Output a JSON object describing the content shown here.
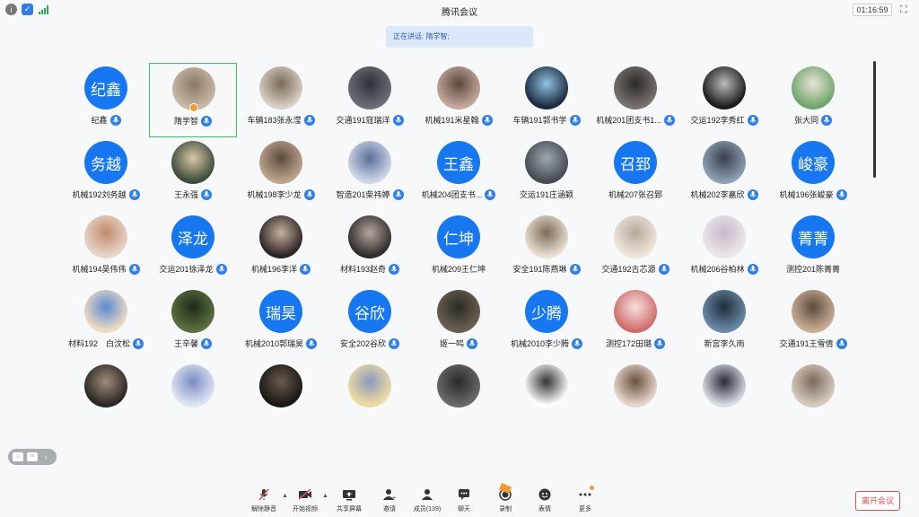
{
  "window": {
    "title": "腾讯会议",
    "timer": "01:16:59"
  },
  "speaking": "正在讲话: 隋学智;",
  "participants": [
    {
      "name": "纪鑫",
      "avatar_text": "纪鑫",
      "mic": true
    },
    {
      "name": "隋学智",
      "avatar_text": "",
      "mic": true,
      "active": true,
      "host": true
    },
    {
      "name": "车辆183张永滢",
      "avatar_text": "",
      "mic": true
    },
    {
      "name": "交通191寇瑞洋",
      "avatar_text": "",
      "mic": true
    },
    {
      "name": "机械191米星翰",
      "avatar_text": "",
      "mic": true
    },
    {
      "name": "车辆191郭书学",
      "avatar_text": "",
      "mic": true
    },
    {
      "name": "机械201团支书1...",
      "avatar_text": "",
      "mic": true
    },
    {
      "name": "交运192李秀红",
      "avatar_text": "",
      "mic": true
    },
    {
      "name": "张大同",
      "avatar_text": "",
      "mic": true
    },
    {
      "name": "机械192刘务越",
      "avatar_text": "务越",
      "mic": true
    },
    {
      "name": "王永强",
      "avatar_text": "",
      "mic": true
    },
    {
      "name": "机械198李少龙",
      "avatar_text": "",
      "mic": true
    },
    {
      "name": "智造201柴祎婷",
      "avatar_text": "",
      "mic": true
    },
    {
      "name": "机械204团支书...",
      "avatar_text": "王鑫",
      "mic": true
    },
    {
      "name": "交运191庄涵颖",
      "avatar_text": "",
      "mic": false
    },
    {
      "name": "机械207张召郅",
      "avatar_text": "召郅",
      "mic": false
    },
    {
      "name": "机械202李嘉欣",
      "avatar_text": "",
      "mic": true
    },
    {
      "name": "机械196张峻豪",
      "avatar_text": "峻豪",
      "mic": true
    },
    {
      "name": "机械194吴伟伟",
      "avatar_text": "",
      "mic": true
    },
    {
      "name": "交运201徐泽龙",
      "avatar_text": "泽龙",
      "mic": true
    },
    {
      "name": "机械196李洋",
      "avatar_text": "",
      "mic": true
    },
    {
      "name": "材料193赵奇",
      "avatar_text": "",
      "mic": true
    },
    {
      "name": "机械209王仁坤",
      "avatar_text": "仁坤",
      "mic": false
    },
    {
      "name": "安全191陈燕琳",
      "avatar_text": "",
      "mic": true
    },
    {
      "name": "交通192古芯源",
      "avatar_text": "",
      "mic": true
    },
    {
      "name": "机械206谷柏林",
      "avatar_text": "",
      "mic": true
    },
    {
      "name": "测控201陈菁菁",
      "avatar_text": "菁菁",
      "mic": false
    },
    {
      "name": "材料192　白汶松",
      "avatar_text": "",
      "mic": true
    },
    {
      "name": "王辛馨",
      "avatar_text": "",
      "mic": true
    },
    {
      "name": "机械2010郭瑞昊",
      "avatar_text": "瑞昊",
      "mic": true
    },
    {
      "name": "安全202谷欣",
      "avatar_text": "谷欣",
      "mic": true
    },
    {
      "name": "姬一鸣",
      "avatar_text": "",
      "mic": true
    },
    {
      "name": "机械2010李少腾",
      "avatar_text": "少腾",
      "mic": true
    },
    {
      "name": "测控172田璐",
      "avatar_text": "",
      "mic": true
    },
    {
      "name": "新宫李久雨",
      "avatar_text": "",
      "mic": false
    },
    {
      "name": "交通191王雪倩",
      "avatar_text": "",
      "mic": true
    }
  ],
  "toolbar": {
    "unmute": "解除静音",
    "start_video": "开始视频",
    "share_screen": "共享屏幕",
    "invite": "邀请",
    "members": "成员(139)",
    "chat": "聊天",
    "record": "录制",
    "reactions": "表情",
    "more": "更多",
    "leave": "离开会议"
  },
  "colors": {
    "accent": "#1677f0",
    "leave": "#e34d4d",
    "active_border": "#3fbf5f"
  }
}
